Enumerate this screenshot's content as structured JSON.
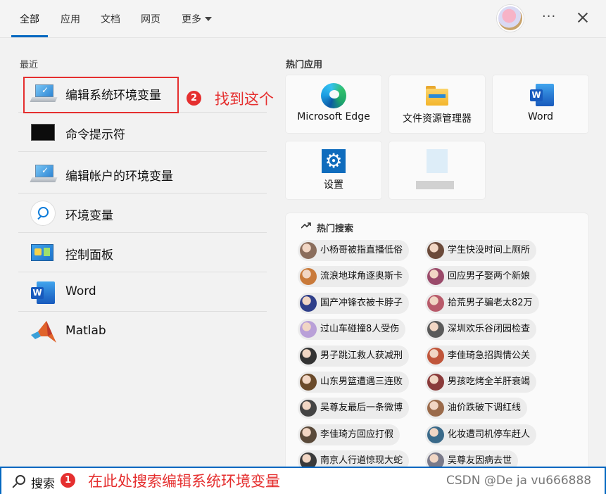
{
  "tabs": [
    {
      "label": "全部",
      "active": true
    },
    {
      "label": "应用"
    },
    {
      "label": "文档"
    },
    {
      "label": "网页"
    },
    {
      "label": "更多"
    }
  ],
  "header": {
    "more_icon": "ellipsis-icon",
    "close_icon": "close-icon"
  },
  "recent": {
    "title": "最近",
    "items": [
      {
        "label": "编辑系统环境变量",
        "icon": "laptop-settings-icon"
      },
      {
        "label": "命令提示符",
        "icon": "command-prompt-icon"
      },
      {
        "label": "编辑帐户的环境变量",
        "icon": "laptop-settings-icon"
      },
      {
        "label": "环境变量",
        "icon": "search-icon"
      },
      {
        "label": "控制面板",
        "icon": "control-panel-icon"
      },
      {
        "label": "Word",
        "icon": "word-icon"
      },
      {
        "label": "Matlab",
        "icon": "matlab-icon"
      }
    ]
  },
  "annotations": {
    "step2_badge": "2",
    "step2_text": "找到这个",
    "step1_badge": "1",
    "step1_text": "在此处搜索编辑系统环境变量"
  },
  "hot_apps": {
    "title": "热门应用",
    "tiles": [
      {
        "label": "Microsoft Edge",
        "icon": "edge-icon"
      },
      {
        "label": "文件资源管理器",
        "icon": "file-explorer-icon"
      },
      {
        "label": "Word",
        "icon": "word-icon"
      },
      {
        "label": "设置",
        "icon": "settings-icon"
      },
      {
        "label": "",
        "icon": "blurred-app-icon"
      }
    ]
  },
  "hot_searches": {
    "title": "热门搜索",
    "items": [
      "小杨哥被指直播低俗",
      "学生快没时间上厕所",
      "流浪地球角逐奥斯卡",
      "回应男子娶两个新娘",
      "国产冲锋衣被卡脖子",
      "拾荒男子骗老太82万",
      "过山车碰撞8人受伤",
      "深圳欢乐谷闭园检查",
      "男子跳江救人获减刑",
      "李佳琦急招舆情公关",
      "山东男篮遭遇三连败",
      "男孩吃烤全羊肝衰竭",
      "吴尊友最后一条微博",
      "油价跌破下调红线",
      "李佳琦方回应打假",
      "化妆遭司机停车赶人",
      "南京人行道惊现大蛇",
      "吴尊友因病去世"
    ],
    "thumb_colors": [
      "#8a6d5c",
      "#6b4a3a",
      "#c97a3a",
      "#9a4a6a",
      "#2f3f8a",
      "#b85a6a",
      "#b9a0d8",
      "#5a5a5a",
      "#333333",
      "#c0553a",
      "#6a4a2a",
      "#8a3a3a",
      "#444444",
      "#9a6a4a",
      "#5a4a3a",
      "#3a6a8a",
      "#3a3a3a",
      "#7a7a8a"
    ]
  },
  "search_bar": {
    "label": "搜索",
    "icon": "search-icon"
  },
  "watermark": "CSDN @De ja vu666888"
}
